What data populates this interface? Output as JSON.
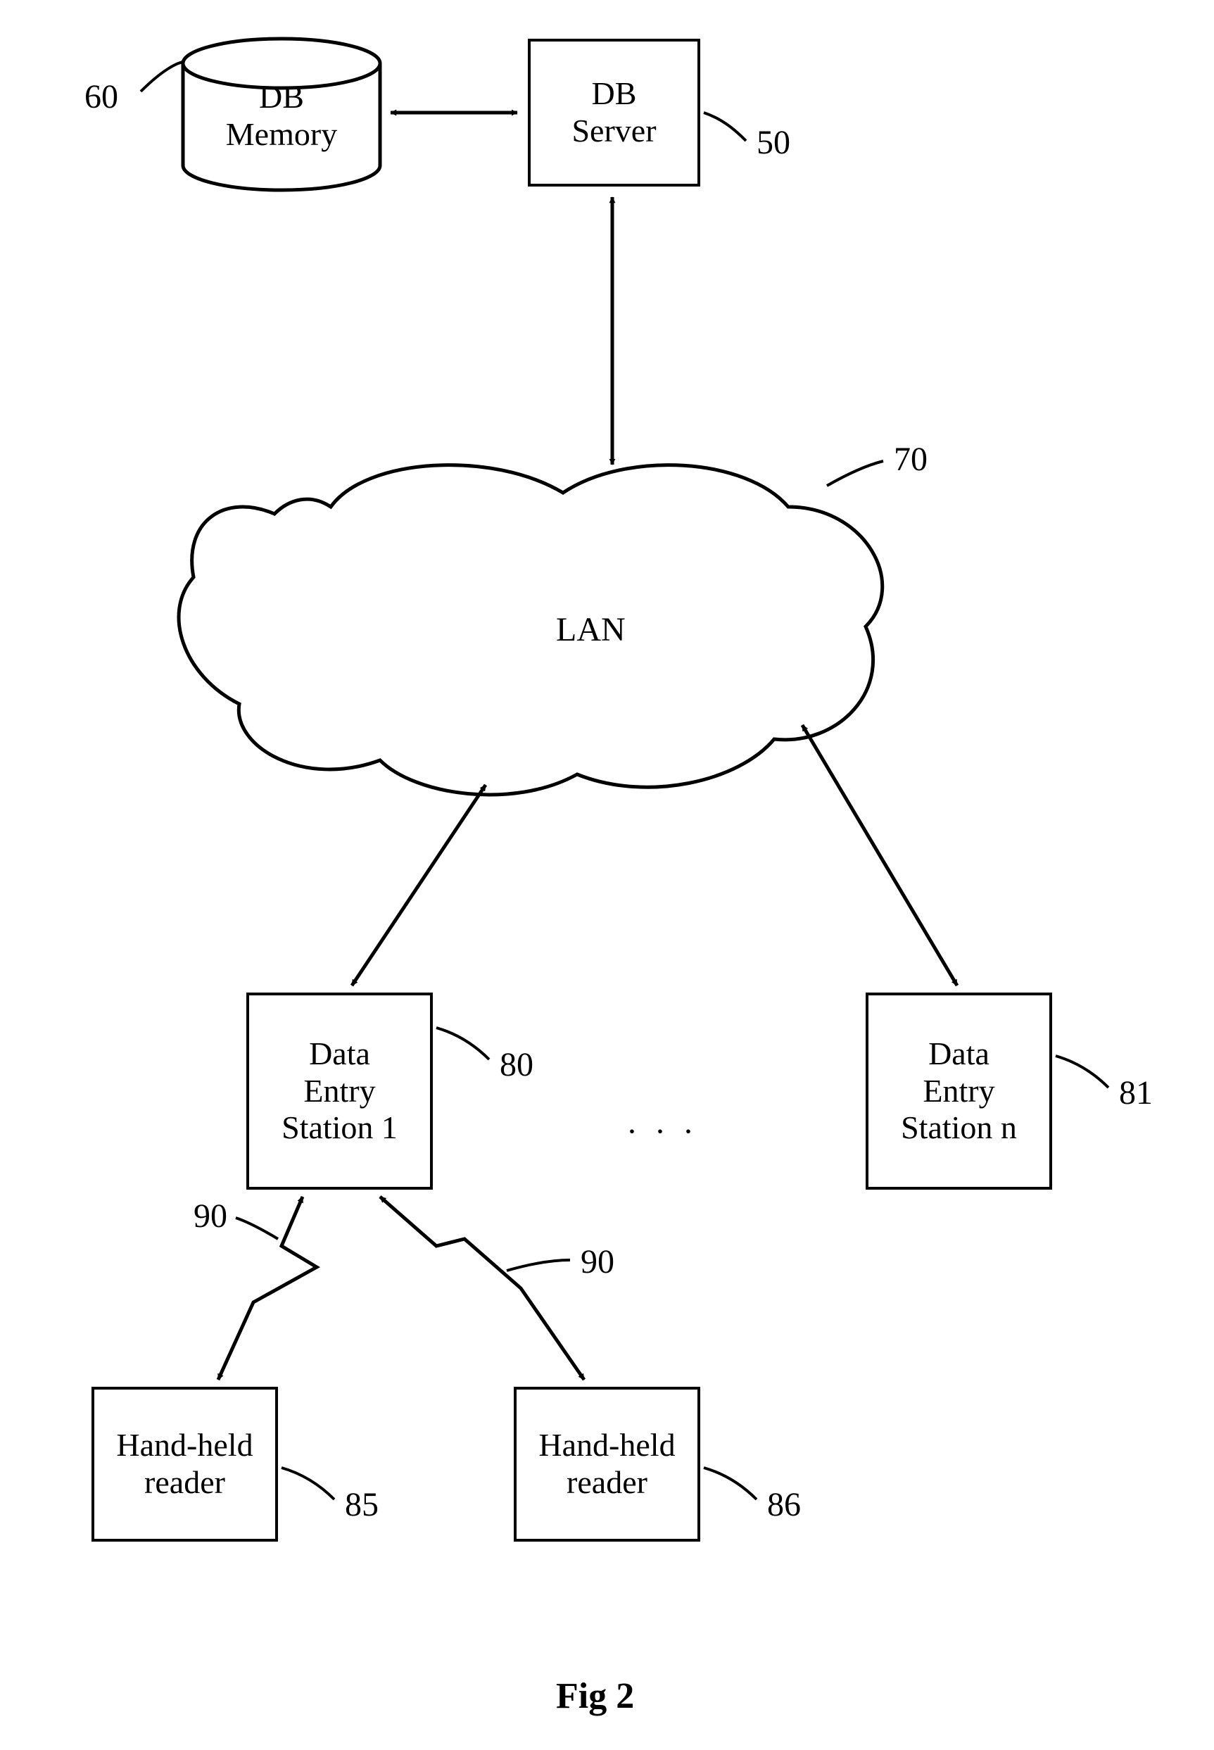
{
  "nodes": {
    "db_memory": {
      "label": "DB\nMemory",
      "ref": "60"
    },
    "db_server": {
      "label": "DB\nServer",
      "ref": "50"
    },
    "lan": {
      "label": "LAN",
      "ref": "70"
    },
    "station1": {
      "label": "Data\nEntry\nStation 1",
      "ref": "80"
    },
    "stationn": {
      "label": "Data\nEntry\nStation n",
      "ref": "81"
    },
    "reader1": {
      "label": "Hand-held\nreader",
      "ref": "85"
    },
    "reader2": {
      "label": "Hand-held\nreader",
      "ref": "86"
    },
    "link_left": {
      "ref": "90"
    },
    "link_right": {
      "ref": "90"
    }
  },
  "misc": {
    "ellipsis": "· · ·",
    "caption": "Fig 2"
  }
}
